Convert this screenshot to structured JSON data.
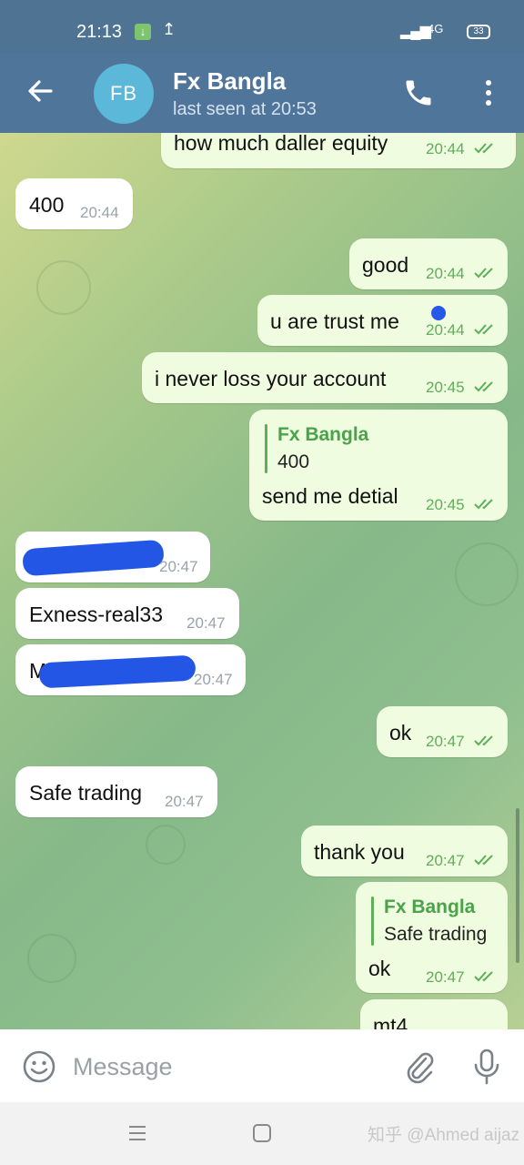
{
  "status_bar": {
    "time": "21:13",
    "network": "4G",
    "battery": "33"
  },
  "header": {
    "avatar_initials": "FB",
    "title": "Fx Bangla",
    "subtitle": "last seen at 20:53"
  },
  "messages": [
    {
      "dir": "out",
      "text": "how much daller equity",
      "time": "20:44"
    },
    {
      "dir": "in",
      "text": "400",
      "time": "20:44"
    },
    {
      "dir": "out",
      "text": "good",
      "time": "20:44"
    },
    {
      "dir": "out",
      "text": "u are trust me",
      "time": "20:44"
    },
    {
      "dir": "out",
      "text": "i never loss your account",
      "time": "20:45"
    },
    {
      "dir": "out",
      "reply_name": "Fx Bangla",
      "reply_text": "400",
      "text": "send me detial",
      "time": "20:45"
    },
    {
      "dir": "in",
      "text": "",
      "time": "20:47",
      "redacted": true
    },
    {
      "dir": "in",
      "text": "Exness-real33",
      "time": "20:47"
    },
    {
      "dir": "in",
      "text": "M",
      "time": "20:47",
      "redacted": true
    },
    {
      "dir": "out",
      "text": "ok",
      "time": "20:47"
    },
    {
      "dir": "in",
      "text": "Safe trading",
      "time": "20:47"
    },
    {
      "dir": "out",
      "text": "thank you",
      "time": "20:47"
    },
    {
      "dir": "out",
      "reply_name": "Fx Bangla",
      "reply_text": "Safe trading",
      "text": "ok",
      "time": "20:47"
    },
    {
      "dir": "out",
      "text": "mt4",
      "time": ""
    }
  ],
  "composer": {
    "placeholder": "Message"
  },
  "watermark": "知乎 @Ahmed aijaz",
  "colors": {
    "header": "#50759a",
    "incoming_bubble": "#ffffff",
    "outgoing_bubble": "#effcdf",
    "outgoing_time": "#5fae5a",
    "avatar": "#5bb8d8",
    "redaction": "#2456e6"
  }
}
